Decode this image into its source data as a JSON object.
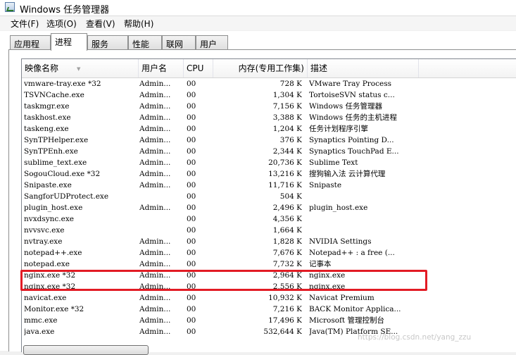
{
  "window": {
    "title": "Windows 任务管理器"
  },
  "menu": [
    {
      "label": "文件(F)"
    },
    {
      "label": "选项(O)"
    },
    {
      "label": "查看(V)"
    },
    {
      "label": "帮助(H)"
    }
  ],
  "tabs": [
    {
      "label": "应用程序"
    },
    {
      "label": "进程",
      "active": true
    },
    {
      "label": "服务"
    },
    {
      "label": "性能"
    },
    {
      "label": "联网"
    },
    {
      "label": "用户"
    }
  ],
  "columns": {
    "name": "映像名称",
    "user": "用户名",
    "cpu": "CPU",
    "mem": "内存(专用工作集)",
    "desc": "描述"
  },
  "processes": [
    {
      "name": "vmware-tray.exe *32",
      "user": "Admin...",
      "cpu": "00",
      "mem": "728 K",
      "desc": "VMware Tray Process"
    },
    {
      "name": "TSVNCache.exe",
      "user": "Admin...",
      "cpu": "00",
      "mem": "1,304 K",
      "desc": "TortoiseSVN status c..."
    },
    {
      "name": "taskmgr.exe",
      "user": "Admin...",
      "cpu": "00",
      "mem": "7,156 K",
      "desc": "Windows 任务管理器"
    },
    {
      "name": "taskhost.exe",
      "user": "Admin...",
      "cpu": "00",
      "mem": "3,388 K",
      "desc": "Windows 任务的主机进程"
    },
    {
      "name": "taskeng.exe",
      "user": "Admin...",
      "cpu": "00",
      "mem": "1,204 K",
      "desc": "任务计划程序引擎"
    },
    {
      "name": "SynTPHelper.exe",
      "user": "Admin...",
      "cpu": "00",
      "mem": "376 K",
      "desc": "Synaptics Pointing D..."
    },
    {
      "name": "SynTPEnh.exe",
      "user": "Admin...",
      "cpu": "00",
      "mem": "2,344 K",
      "desc": "Synaptics TouchPad E..."
    },
    {
      "name": "sublime_text.exe",
      "user": "Admin...",
      "cpu": "00",
      "mem": "20,736 K",
      "desc": "Sublime Text"
    },
    {
      "name": "SogouCloud.exe *32",
      "user": "Admin...",
      "cpu": "00",
      "mem": "13,216 K",
      "desc": "搜狗输入法 云计算代理"
    },
    {
      "name": "Snipaste.exe",
      "user": "Admin...",
      "cpu": "00",
      "mem": "11,716 K",
      "desc": "Snipaste"
    },
    {
      "name": "SangforUDProtect.exe",
      "user": "",
      "cpu": "00",
      "mem": "504 K",
      "desc": ""
    },
    {
      "name": "plugin_host.exe",
      "user": "Admin...",
      "cpu": "00",
      "mem": "2,496 K",
      "desc": "plugin_host.exe"
    },
    {
      "name": "nvxdsync.exe",
      "user": "",
      "cpu": "00",
      "mem": "4,356 K",
      "desc": ""
    },
    {
      "name": "nvvsvc.exe",
      "user": "",
      "cpu": "00",
      "mem": "1,664 K",
      "desc": ""
    },
    {
      "name": "nvtray.exe",
      "user": "Admin...",
      "cpu": "00",
      "mem": "1,828 K",
      "desc": "NVIDIA Settings"
    },
    {
      "name": "notepad++.exe",
      "user": "Admin...",
      "cpu": "00",
      "mem": "7,676 K",
      "desc": "Notepad++ : a free (..."
    },
    {
      "name": "notepad.exe",
      "user": "Admin...",
      "cpu": "00",
      "mem": "7,732 K",
      "desc": "记事本"
    },
    {
      "name": "nginx.exe *32",
      "user": "Admin...",
      "cpu": "00",
      "mem": "2,964 K",
      "desc": "nginx.exe",
      "highlighted": true
    },
    {
      "name": "nginx.exe *32",
      "user": "Admin...",
      "cpu": "00",
      "mem": "2,556 K",
      "desc": "nginx.exe",
      "highlighted": true
    },
    {
      "name": "navicat.exe",
      "user": "Admin...",
      "cpu": "00",
      "mem": "10,932 K",
      "desc": "Navicat Premium"
    },
    {
      "name": "Monitor.exe *32",
      "user": "Admin...",
      "cpu": "00",
      "mem": "7,216 K",
      "desc": "BACK Monitor Applica..."
    },
    {
      "name": "mmc.exe",
      "user": "Admin...",
      "cpu": "00",
      "mem": "17,496 K",
      "desc": "Microsoft 管理控制台"
    },
    {
      "name": "java.exe",
      "user": "Admin...",
      "cpu": "00",
      "mem": "532,644 K",
      "desc": "Java(TM) Platform SE..."
    }
  ],
  "annotation": {
    "color": "#e21b24"
  },
  "watermark": "https://blog.csdn.net/yang_zzu"
}
